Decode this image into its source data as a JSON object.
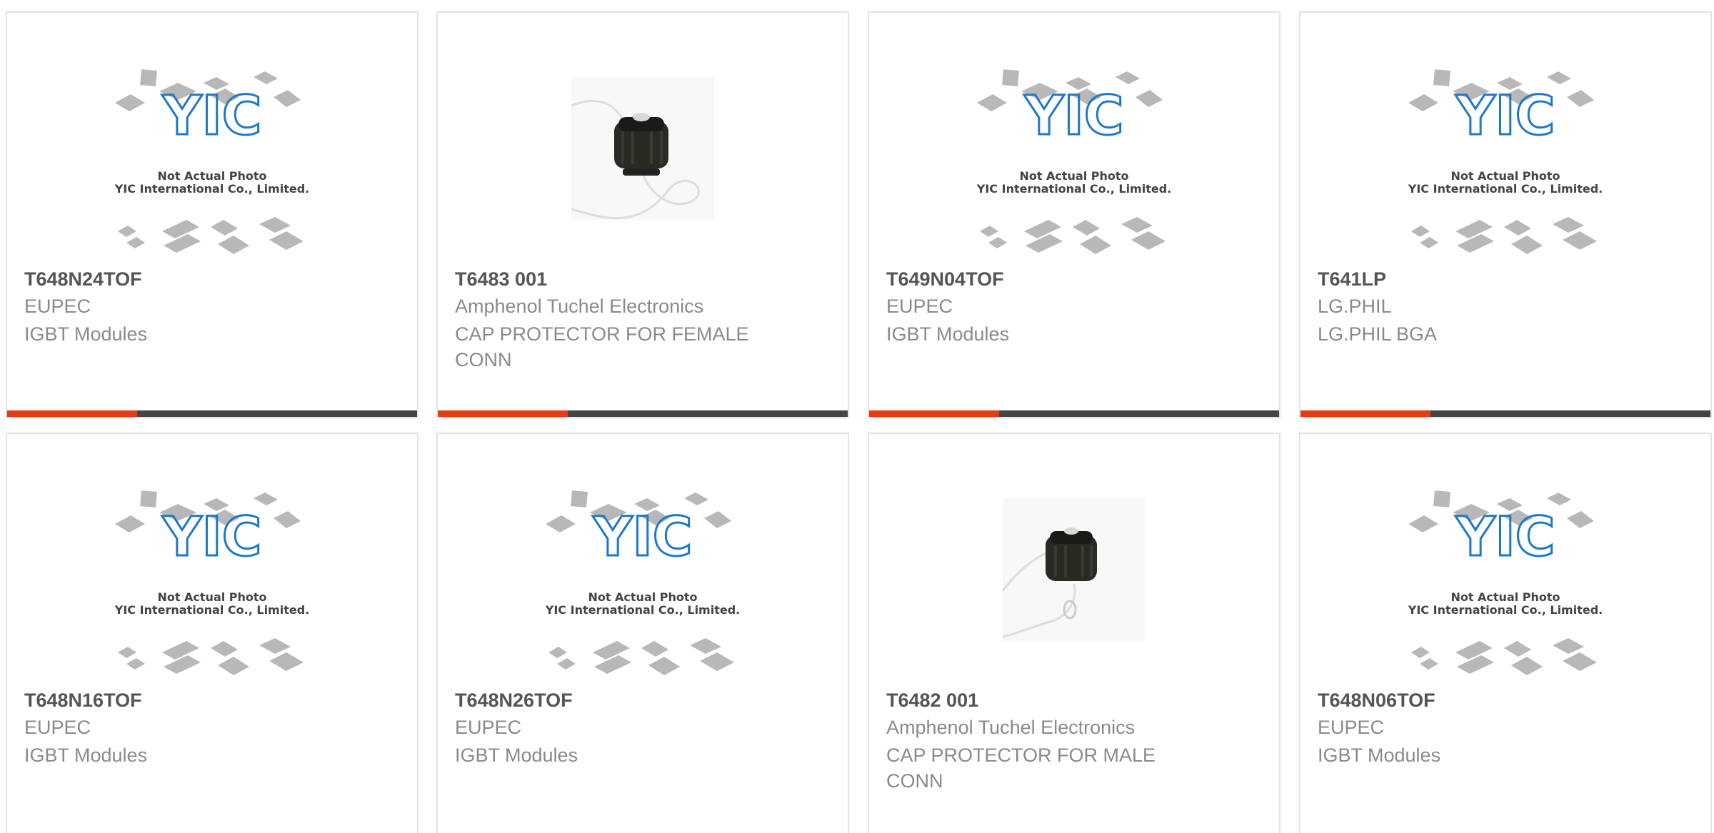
{
  "colors": {
    "accent": "#e33d12",
    "bar": "#444444",
    "border": "#e3e3e3",
    "part_number": "#555555",
    "text": "#8a8a8a",
    "logo": "#1e78c8"
  },
  "placeholder": {
    "line1": "Not Actual Photo",
    "line2": "YIC International Co., Limited.",
    "logo_text": "YIC"
  },
  "products": [
    {
      "part_number": "T648N24TOF",
      "manufacturer": "EUPEC",
      "description": "IGBT Modules",
      "image": "yic-placeholder"
    },
    {
      "part_number": "T6483 001",
      "manufacturer": "Amphenol Tuchel Electronics",
      "description": "CAP PROTECTOR FOR FEMALE CONN",
      "image": "cap-protector-photo"
    },
    {
      "part_number": "T649N04TOF",
      "manufacturer": "EUPEC",
      "description": "IGBT Modules",
      "image": "yic-placeholder"
    },
    {
      "part_number": "T641LP",
      "manufacturer": "LG.PHIL",
      "description": "LG.PHIL BGA",
      "image": "yic-placeholder"
    },
    {
      "part_number": "T648N16TOF",
      "manufacturer": "EUPEC",
      "description": "IGBT Modules",
      "image": "yic-placeholder"
    },
    {
      "part_number": "T648N26TOF",
      "manufacturer": "EUPEC",
      "description": "IGBT Modules",
      "image": "yic-placeholder"
    },
    {
      "part_number": "T6482 001",
      "manufacturer": "Amphenol Tuchel Electronics",
      "description": "CAP PROTECTOR FOR MALE CONN",
      "image": "cap-protector-photo"
    },
    {
      "part_number": "T648N06TOF",
      "manufacturer": "EUPEC",
      "description": "IGBT Modules",
      "image": "yic-placeholder"
    }
  ]
}
